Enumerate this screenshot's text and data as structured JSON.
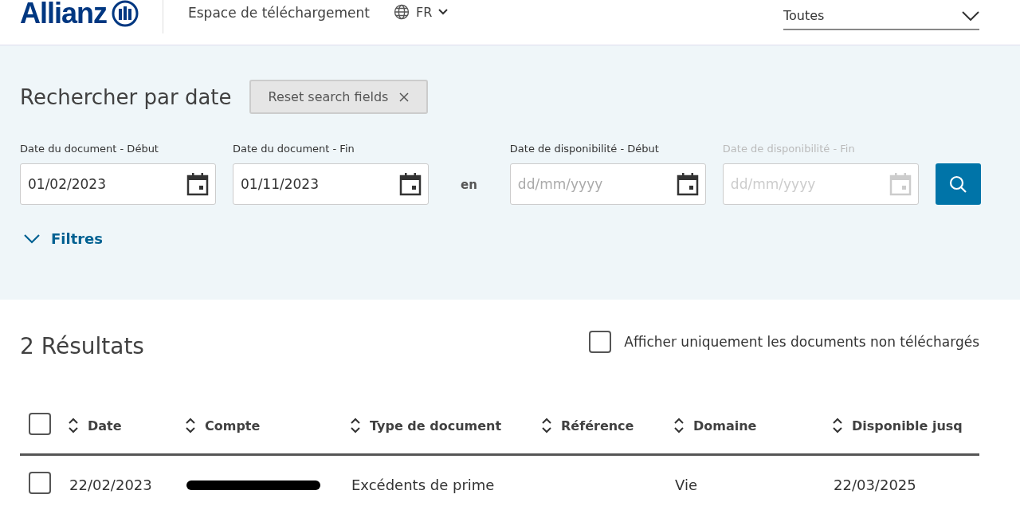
{
  "header": {
    "logo": "Allianz",
    "title": "Espace de téléchargement",
    "language": "FR",
    "relation": {
      "value": "Toutes"
    }
  },
  "search": {
    "title": "Rechercher par date",
    "reset_button": "Reset search fields",
    "separator": "en",
    "fields": [
      {
        "label": "Date du document - Début",
        "value": "01/02/2023",
        "disabled": false
      },
      {
        "label": "Date du document - Fin",
        "value": "01/11/2023",
        "disabled": false
      },
      {
        "label": "Date de disponibilité - Début",
        "placeholder": "dd/mm/yyyy",
        "disabled": false
      },
      {
        "label": "Date de disponibilité - Fin",
        "placeholder": "dd/mm/yyyy",
        "disabled": true
      }
    ],
    "filters": {
      "label": "Filtres",
      "expanded": false
    }
  },
  "results": {
    "count": "2 Résultats",
    "only_not_downloaded": {
      "label": "Afficher uniquement les documents non téléchargés",
      "checked": false
    }
  },
  "table": {
    "select_all_checked": false,
    "columns": [
      "Date",
      "Compte",
      "Type de document",
      "Référence",
      "Domaine",
      "Disponible jusq"
    ],
    "rows": [
      {
        "selected": false,
        "cells": [
          {
            "kind": "text",
            "text": "22/02/2023"
          },
          {
            "kind": "redacted"
          },
          {
            "kind": "text",
            "text": "Excédents de prime"
          },
          {
            "kind": "empty"
          },
          {
            "kind": "text",
            "text": "Vie"
          },
          {
            "kind": "text",
            "text": "22/03/2025"
          }
        ]
      }
    ]
  }
}
